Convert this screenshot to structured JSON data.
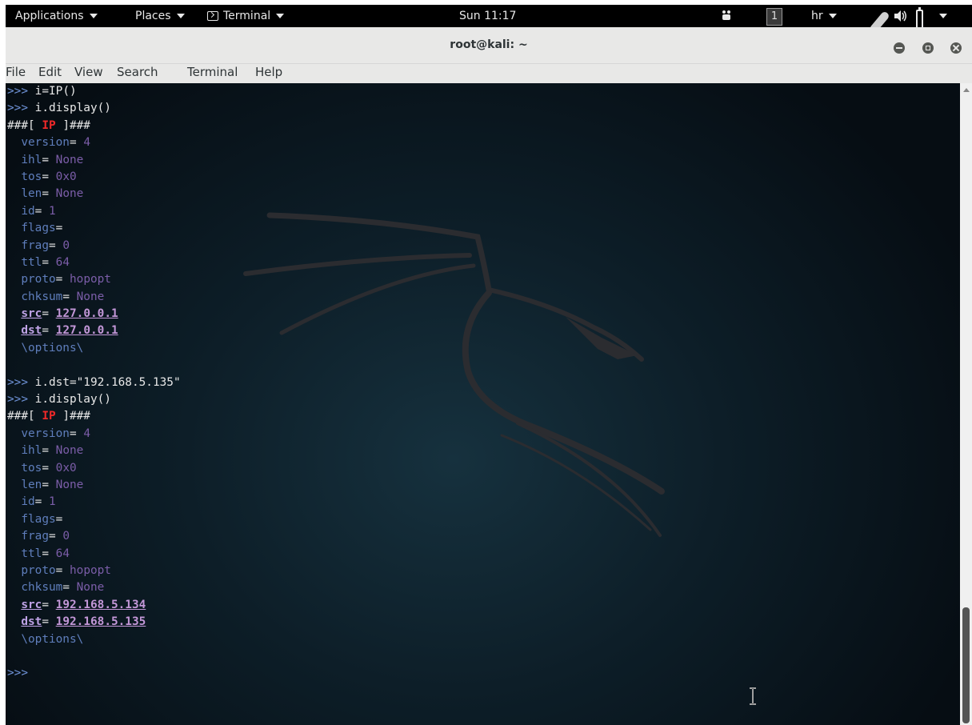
{
  "topbar": {
    "applications": "Applications",
    "places": "Places",
    "terminal_app": "Terminal",
    "clock": "Sun 11:17",
    "workspace": "1",
    "keyboard": "hr"
  },
  "window": {
    "title": "root@kali: ~"
  },
  "menu": [
    "File",
    "Edit",
    "View",
    "Search",
    "Terminal",
    "Help"
  ],
  "session": {
    "prompt": ">>>",
    "cmd1": " i=IP()",
    "cmd2": " i.display()",
    "cmd3": " i.dst=\"192.168.5.135\"",
    "cmd4": " i.display()",
    "hdr_pre": "###[ ",
    "hdr_name": "IP",
    "hdr_post": " ]###",
    "eq": "=",
    "options": "\\options\\",
    "fields": {
      "version": "version",
      "ihl": "ihl",
      "tos": "tos",
      "len": "len",
      "id": "id",
      "flags": "flags",
      "frag": "frag",
      "ttl": "ttl",
      "proto": "proto",
      "chksum": "chksum",
      "src": "src",
      "dst": "dst"
    },
    "block1": {
      "version": " 4",
      "ihl": " None",
      "tos": " 0x0",
      "len": " None",
      "id": " 1",
      "frag": " 0",
      "ttl": " 64",
      "proto": " hopopt",
      "chksum": " None",
      "src": "127.0.0.1",
      "dst": "127.0.0.1"
    },
    "block2": {
      "version": " 4",
      "ihl": " None",
      "tos": " 0x0",
      "len": " None",
      "id": " 1",
      "frag": " 0",
      "ttl": " 64",
      "proto": " hopopt",
      "chksum": " None",
      "src": "192.168.5.134",
      "dst": "192.168.5.135"
    }
  },
  "colors": {
    "prompt": "#6f93d8",
    "layer_name": "#ef2929",
    "field_name": "#5f7ebc",
    "field_value": "#7b5da8",
    "address": "#c397d8"
  },
  "icons": [
    "terminal-app-icon",
    "workspace-indicator",
    "microphone-icon",
    "speaker-icon",
    "battery-icon",
    "minimize-icon",
    "maximize-icon",
    "close-icon",
    "kali-dragon-logo",
    "text-cursor-icon"
  ]
}
